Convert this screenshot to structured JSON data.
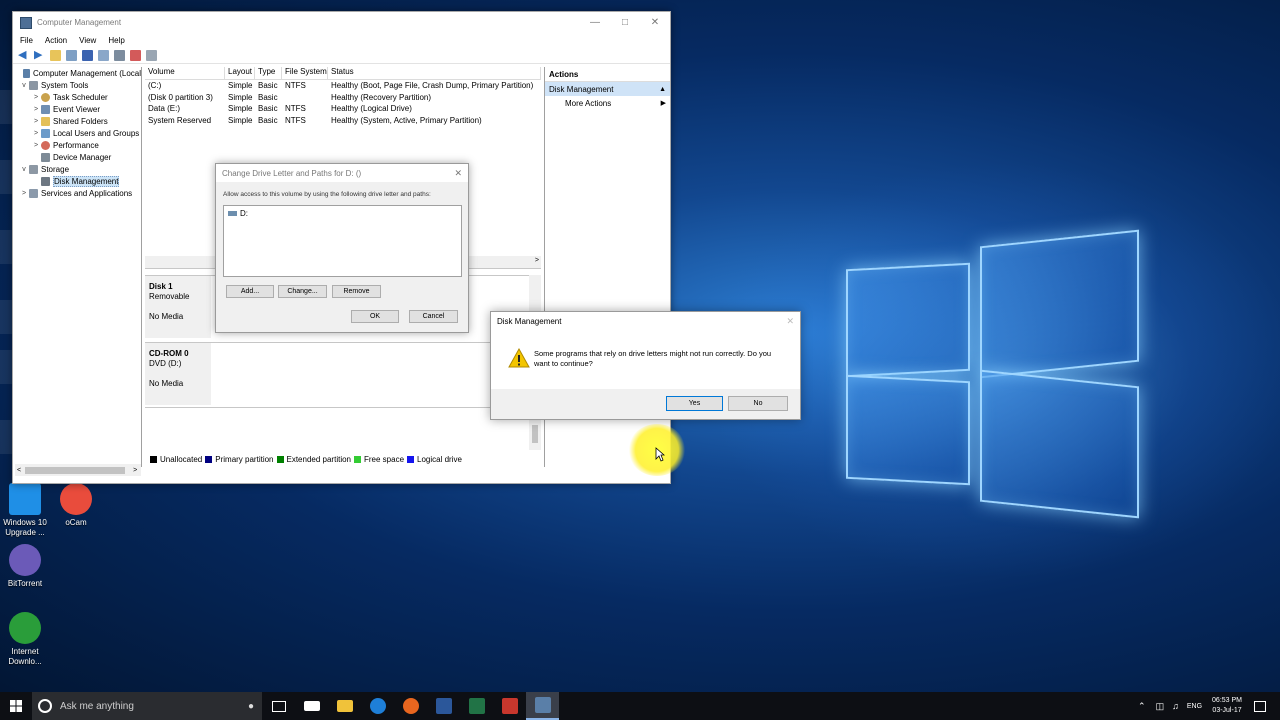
{
  "desktop": {
    "icons": [
      {
        "label": "Windows 10 Upgrade ...",
        "color": "#1f8fe6"
      },
      {
        "label": "oCam",
        "color": "#e94c3c"
      },
      {
        "label": "BitTorrent",
        "color": "#6b5ab8"
      },
      {
        "label": "Internet Downlo...",
        "color": "#2a9d3a"
      }
    ]
  },
  "window": {
    "title": "Computer Management",
    "menu": [
      "File",
      "Action",
      "View",
      "Help"
    ],
    "tree": [
      {
        "label": "Computer Management (Local",
        "exp": "",
        "indent": 0
      },
      {
        "label": "System Tools",
        "exp": "v",
        "indent": 1
      },
      {
        "label": "Task Scheduler",
        "exp": ">",
        "indent": 2
      },
      {
        "label": "Event Viewer",
        "exp": ">",
        "indent": 2
      },
      {
        "label": "Shared Folders",
        "exp": ">",
        "indent": 2
      },
      {
        "label": "Local Users and Groups",
        "exp": ">",
        "indent": 2
      },
      {
        "label": "Performance",
        "exp": ">",
        "indent": 2
      },
      {
        "label": "Device Manager",
        "exp": "",
        "indent": 2
      },
      {
        "label": "Storage",
        "exp": "v",
        "indent": 1
      },
      {
        "label": "Disk Management",
        "exp": "",
        "indent": 2
      },
      {
        "label": "Services and Applications",
        "exp": ">",
        "indent": 1
      }
    ],
    "columns": [
      "Volume",
      "Layout",
      "Type",
      "File System",
      "Status"
    ],
    "volumes": [
      [
        "(C:)",
        "Simple",
        "Basic",
        "NTFS",
        "Healthy (Boot, Page File, Crash Dump, Primary Partition)"
      ],
      [
        "(Disk 0 partition 3)",
        "Simple",
        "Basic",
        "",
        "Healthy (Recovery Partition)"
      ],
      [
        "Data (E:)",
        "Simple",
        "Basic",
        "NTFS",
        "Healthy (Logical Drive)"
      ],
      [
        "System Reserved",
        "Simple",
        "Basic",
        "NTFS",
        "Healthy (System, Active, Primary Partition)"
      ]
    ],
    "disks": [
      {
        "name": "Disk 1",
        "type": "Removable",
        "status": "No Media"
      },
      {
        "name": "CD-ROM 0",
        "type": "DVD (D:)",
        "status": "No Media"
      }
    ],
    "legend": [
      {
        "label": "Unallocated",
        "color": "#000000"
      },
      {
        "label": "Primary partition",
        "color": "#000080"
      },
      {
        "label": "Extended partition",
        "color": "#008000"
      },
      {
        "label": "Free space",
        "color": "#33cc33"
      },
      {
        "label": "Logical drive",
        "color": "#1515ee"
      }
    ],
    "actions": {
      "header": "Actions",
      "selected": "Disk Management",
      "more": "More Actions"
    }
  },
  "change_dialog": {
    "title": "Change Drive Letter and Paths for D: ()",
    "instruction": "Allow access to this volume by using the following drive letter and paths:",
    "entry": "D:",
    "add": "Add...",
    "change": "Change...",
    "remove": "Remove",
    "ok": "OK",
    "cancel": "Cancel"
  },
  "confirm_dialog": {
    "title": "Disk Management",
    "message": "Some programs that rely on drive letters might not run correctly. Do you want to continue?",
    "yes": "Yes",
    "no": "No"
  },
  "taskbar": {
    "search_placeholder": "Ask me anything",
    "apps": [
      {
        "name": "task-view",
        "color": "#ffffff"
      },
      {
        "name": "mail",
        "color": "#ffffff"
      },
      {
        "name": "file-explorer",
        "color": "#f0c23a"
      },
      {
        "name": "edge",
        "color": "#1e7fd8"
      },
      {
        "name": "firefox",
        "color": "#e8661f"
      },
      {
        "name": "word",
        "color": "#2b579a"
      },
      {
        "name": "excel",
        "color": "#217346"
      },
      {
        "name": "ocam",
        "color": "#c8372d"
      },
      {
        "name": "computer-management",
        "color": "#5a7fa8"
      }
    ],
    "language": "ENG",
    "time": "06:53 PM",
    "date": "03-Jul-17"
  }
}
